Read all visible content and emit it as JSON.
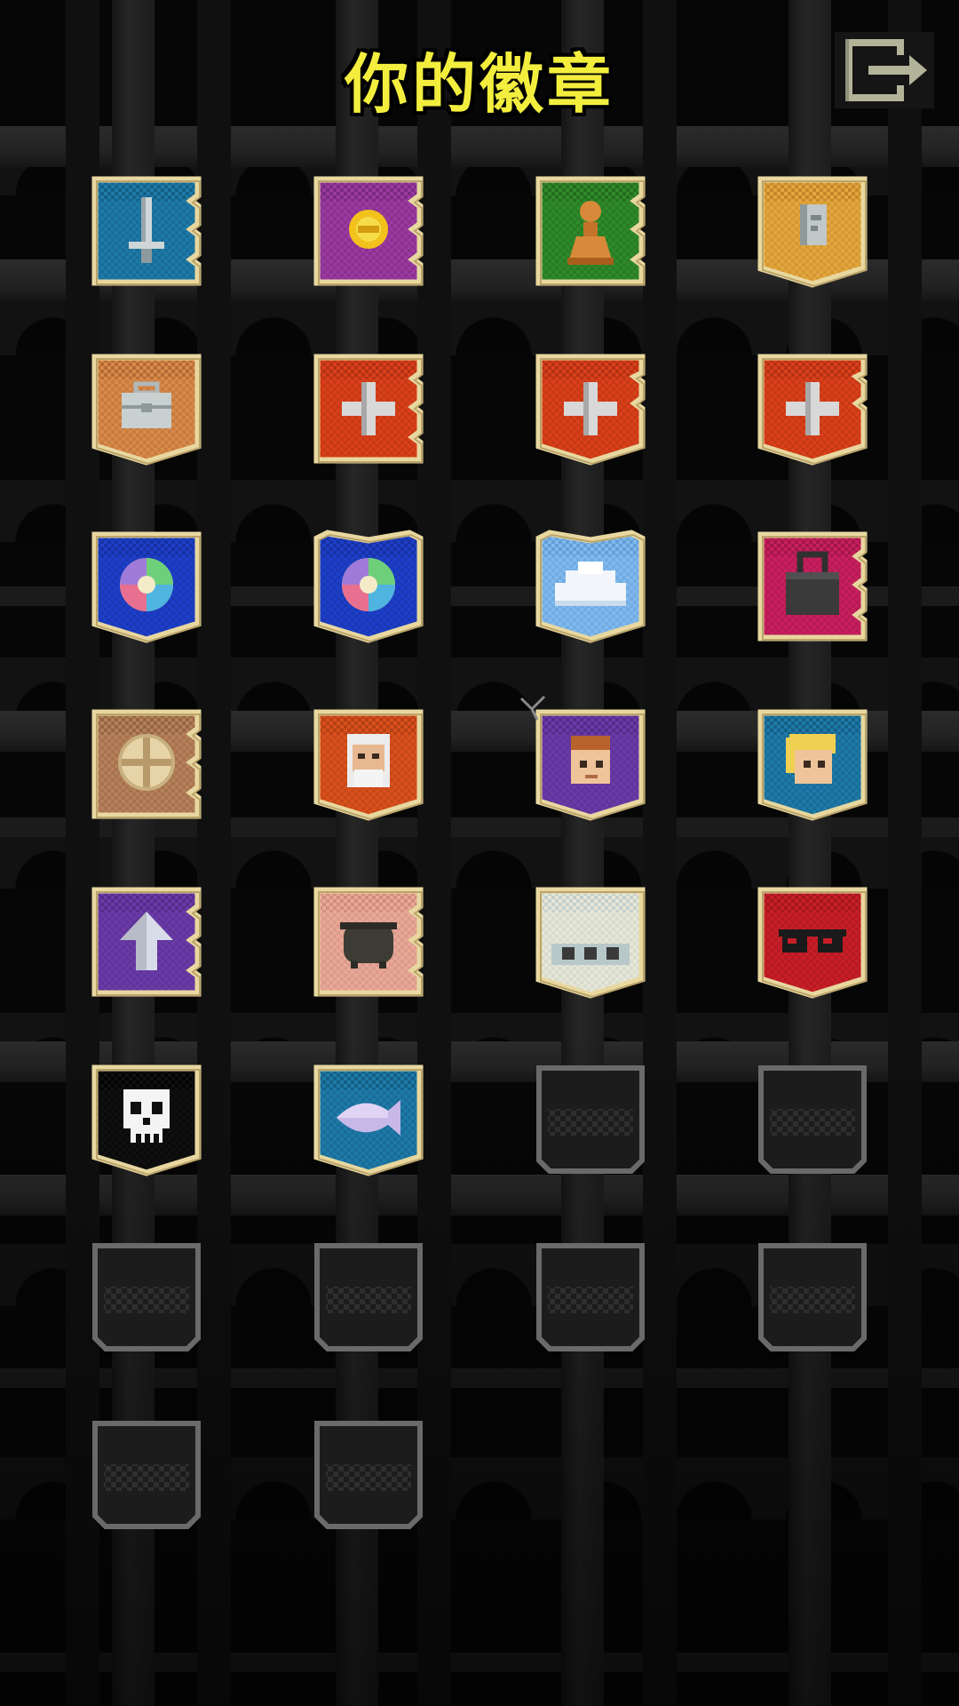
{
  "header": {
    "title": "你的徽章",
    "exit_icon": "exit-door-arrow-icon"
  },
  "colors": {
    "title": "#f3ee3e",
    "frame_gold": "#e8d8a0",
    "frame_gold_dark": "#a88f52",
    "locked_frame": "#6a6a6a"
  },
  "badges": [
    {
      "name": "sword",
      "icon": "sword-icon",
      "bg": "#1e7aa8",
      "bg_dark": "#12557a",
      "shape": "notch",
      "locked": false
    },
    {
      "name": "gold-coin",
      "icon": "gold-coin-icon",
      "bg": "#9a3aa0",
      "bg_dark": "#6e2474",
      "shape": "notch",
      "locked": false
    },
    {
      "name": "chess-pawn",
      "icon": "pawn-icon",
      "bg": "#2f8a2a",
      "bg_dark": "#1e621c",
      "shape": "notch",
      "locked": false
    },
    {
      "name": "stone-tablet",
      "icon": "tablet-icon",
      "bg": "#e3a63c",
      "bg_dark": "#b97d24",
      "shape": "pointed",
      "locked": false
    },
    {
      "name": "briefcase",
      "icon": "briefcase-icon",
      "bg": "#d88a4a",
      "bg_dark": "#a9602c",
      "shape": "pointed",
      "locked": false
    },
    {
      "name": "plus-bronze",
      "icon": "plus-icon",
      "bg": "#d9401a",
      "bg_dark": "#a82c10",
      "shape": "notch",
      "locked": false
    },
    {
      "name": "plus-silver",
      "icon": "plus-icon",
      "bg": "#d9401a",
      "bg_dark": "#a82c10",
      "shape": "pointed-notch",
      "locked": false
    },
    {
      "name": "plus-gold",
      "icon": "plus-icon",
      "bg": "#d9401a",
      "bg_dark": "#a82c10",
      "shape": "pointed-notch",
      "locked": false
    },
    {
      "name": "rainbow-orb",
      "icon": "orb-icon",
      "bg": "#1d3fc8",
      "bg_dark": "#142c96",
      "shape": "pointed",
      "locked": false
    },
    {
      "name": "rainbow-orb-2",
      "icon": "orb-icon",
      "bg": "#1d3fc8",
      "bg_dark": "#142c96",
      "shape": "pointed-top",
      "locked": false
    },
    {
      "name": "cloud",
      "icon": "cloud-icon",
      "bg": "#7fb8ec",
      "bg_dark": "#5a95d0",
      "shape": "pointed-top",
      "locked": false
    },
    {
      "name": "padlock",
      "icon": "padlock-icon",
      "bg": "#c81f5e",
      "bg_dark": "#961444",
      "shape": "notch",
      "locked": false
    },
    {
      "name": "wooden-shield",
      "icon": "round-shield-icon",
      "bg": "#b5805a",
      "bg_dark": "#8a5c3c",
      "shape": "notch",
      "locked": false
    },
    {
      "name": "old-wizard",
      "icon": "old-man-face-icon",
      "bg": "#d9501c",
      "bg_dark": "#a83a12",
      "shape": "pointed",
      "locked": false
    },
    {
      "name": "hero-boy",
      "icon": "boy-face-icon",
      "bg": "#6a3aa8",
      "bg_dark": "#4c287e",
      "shape": "pointed",
      "locked": false
    },
    {
      "name": "blonde-girl",
      "icon": "blonde-face-icon",
      "bg": "#1e7aa8",
      "bg_dark": "#12557a",
      "shape": "pointed",
      "locked": false
    },
    {
      "name": "up-arrow",
      "icon": "up-arrow-icon",
      "bg": "#6a3aa8",
      "bg_dark": "#4c287e",
      "shape": "notch",
      "locked": false
    },
    {
      "name": "cauldron",
      "icon": "cauldron-icon",
      "bg": "#e8a898",
      "bg_dark": "#c98474",
      "shape": "notch",
      "locked": false
    },
    {
      "name": "ellipsis-scroll",
      "icon": "ellipsis-icon",
      "bg": "#e8e6d6",
      "bg_dark": "#b8c8c8",
      "shape": "pointed",
      "locked": false
    },
    {
      "name": "sunglasses",
      "icon": "sunglasses-icon",
      "bg": "#c81e28",
      "bg_dark": "#961419",
      "shape": "pointed",
      "locked": false
    },
    {
      "name": "skull",
      "icon": "skull-icon",
      "bg": "#101010",
      "bg_dark": "#000000",
      "shape": "pointed",
      "locked": false
    },
    {
      "name": "fish",
      "icon": "fish-icon",
      "bg": "#1e7aa8",
      "bg_dark": "#12557a",
      "shape": "pointed",
      "locked": false
    },
    {
      "name": "locked-1",
      "icon": "empty-slot-icon",
      "locked": true
    },
    {
      "name": "locked-2",
      "icon": "empty-slot-icon",
      "locked": true
    },
    {
      "name": "locked-3",
      "icon": "empty-slot-icon",
      "locked": true
    },
    {
      "name": "locked-4",
      "icon": "empty-slot-icon",
      "locked": true
    },
    {
      "name": "locked-5",
      "icon": "empty-slot-icon",
      "locked": true
    },
    {
      "name": "locked-6",
      "icon": "empty-slot-icon",
      "locked": true
    },
    {
      "name": "locked-7",
      "icon": "empty-slot-icon",
      "locked": true
    },
    {
      "name": "locked-8",
      "icon": "empty-slot-icon",
      "locked": true
    }
  ]
}
